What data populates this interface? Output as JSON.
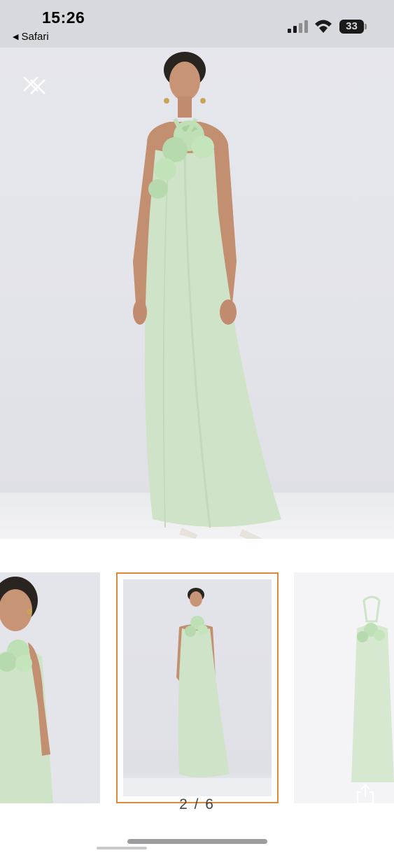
{
  "status_bar": {
    "time": "15:26",
    "back_app": "Safari",
    "battery": "33",
    "icons": [
      "cellular-signal-icon",
      "wifi-icon",
      "battery-icon"
    ]
  },
  "viewer": {
    "close_icon": "close-icon",
    "page_indicator": "2 / 6",
    "share_icon": "share-icon",
    "accent_color": "#d98a3a",
    "dress_color": "#cfe3c8"
  }
}
